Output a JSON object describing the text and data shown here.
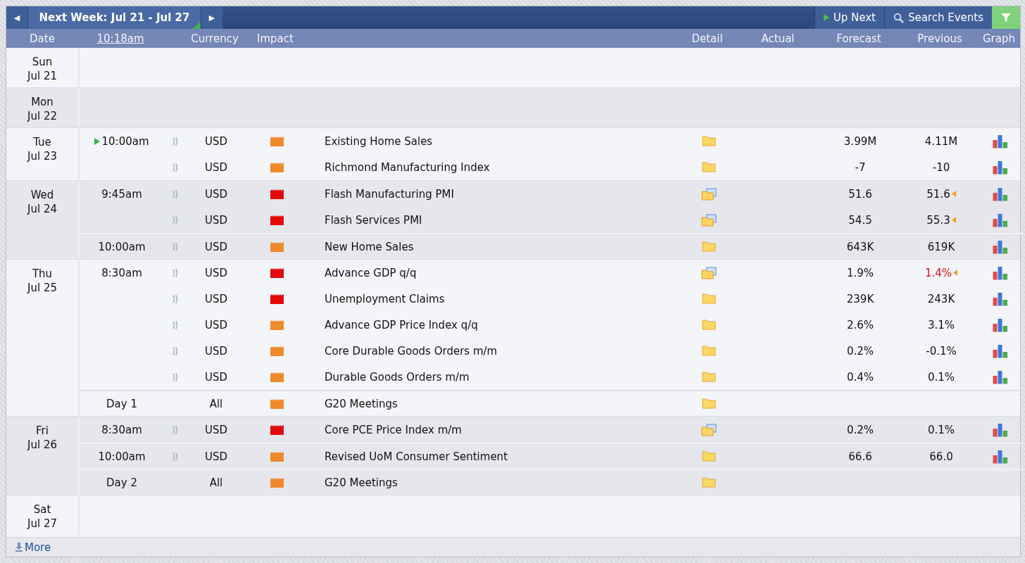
{
  "toolbar": {
    "prev": "◀",
    "title": "Next Week: Jul 21 - Jul 27",
    "next": "▶",
    "up_next": "Up Next",
    "search": "Search Events"
  },
  "columns": [
    {
      "label": "Date",
      "kind": "text"
    },
    {
      "label": "10:18am",
      "kind": "link"
    },
    {
      "label": "Currency",
      "kind": "text"
    },
    {
      "label": "Impact",
      "kind": "text"
    },
    {
      "label": "Detail",
      "kind": "text"
    },
    {
      "label": "Actual",
      "kind": "text"
    },
    {
      "label": "Forecast",
      "kind": "text"
    },
    {
      "label": "Previous",
      "kind": "text"
    },
    {
      "label": "Graph",
      "kind": "text"
    }
  ],
  "days": [
    {
      "day": "Sun",
      "date": "Jul 21"
    },
    {
      "day": "Mon",
      "date": "Jul 22"
    },
    {
      "day": "Tue",
      "date": "Jul 23",
      "events": [
        {
          "time": "10:00am",
          "up_next": true,
          "alert": true,
          "currency": "USD",
          "impact": {
            "color": "#ef8a2b"
          },
          "title": "Existing Home Sales",
          "detail": {
            "kind": "folder"
          },
          "forecast": "3.99M",
          "previous": "4.11M",
          "previous_worse": false,
          "revised": false,
          "graph": true
        },
        {
          "up_next": false,
          "alert": true,
          "currency": "USD",
          "impact": {
            "color": "#ef8a2b"
          },
          "title": "Richmond Manufacturing Index",
          "detail": {
            "kind": "folder"
          },
          "forecast": "-7",
          "previous": "-10",
          "previous_worse": false,
          "revised": false,
          "graph": true
        }
      ]
    },
    {
      "day": "Wed",
      "date": "Jul 24",
      "events": [
        {
          "time": "9:45am",
          "up_next": false,
          "alert": true,
          "currency": "USD",
          "impact": {
            "color": "#e20a0a"
          },
          "title": "Flash Manufacturing PMI",
          "detail": {
            "kind": "folder-doc"
          },
          "forecast": "51.6",
          "previous": "51.6",
          "previous_worse": false,
          "revised": true,
          "graph": true
        },
        {
          "up_next": false,
          "alert": true,
          "currency": "USD",
          "impact": {
            "color": "#e20a0a"
          },
          "title": "Flash Services PMI",
          "detail": {
            "kind": "folder-doc"
          },
          "forecast": "54.5",
          "previous": "55.3",
          "previous_worse": false,
          "revised": true,
          "graph": true
        },
        {
          "time": "10:00am",
          "up_next": false,
          "alert": true,
          "currency": "USD",
          "impact": {
            "color": "#ef8a2b"
          },
          "title": "New Home Sales",
          "detail": {
            "kind": "folder"
          },
          "forecast": "643K",
          "previous": "619K",
          "previous_worse": false,
          "revised": false,
          "graph": true
        }
      ]
    },
    {
      "day": "Thu",
      "date": "Jul 25",
      "events": [
        {
          "time": "8:30am",
          "up_next": false,
          "alert": true,
          "currency": "USD",
          "impact": {
            "color": "#e20a0a"
          },
          "title": "Advance GDP q/q",
          "detail": {
            "kind": "folder-doc"
          },
          "forecast": "1.9%",
          "previous": "1.4%",
          "previous_worse": true,
          "revised": true,
          "graph": true
        },
        {
          "up_next": false,
          "alert": true,
          "currency": "USD",
          "impact": {
            "color": "#e20a0a"
          },
          "title": "Unemployment Claims",
          "detail": {
            "kind": "folder"
          },
          "forecast": "239K",
          "previous": "243K",
          "previous_worse": false,
          "revised": false,
          "graph": true
        },
        {
          "up_next": false,
          "alert": true,
          "currency": "USD",
          "impact": {
            "color": "#ef8a2b"
          },
          "title": "Advance GDP Price Index q/q",
          "detail": {
            "kind": "folder"
          },
          "forecast": "2.6%",
          "previous": "3.1%",
          "previous_worse": false,
          "revised": false,
          "graph": true
        },
        {
          "up_next": false,
          "alert": true,
          "currency": "USD",
          "impact": {
            "color": "#ef8a2b"
          },
          "title": "Core Durable Goods Orders m/m",
          "detail": {
            "kind": "folder"
          },
          "forecast": "0.2%",
          "previous": "-0.1%",
          "previous_worse": false,
          "revised": false,
          "graph": true
        },
        {
          "up_next": false,
          "alert": true,
          "currency": "USD",
          "impact": {
            "color": "#ef8a2b"
          },
          "title": "Durable Goods Orders m/m",
          "detail": {
            "kind": "folder"
          },
          "forecast": "0.4%",
          "previous": "0.1%",
          "previous_worse": false,
          "revised": false,
          "graph": true
        },
        {
          "time": "Day 1",
          "up_next": false,
          "alert": false,
          "currency": "All",
          "impact": {
            "color": "#ef8a2b"
          },
          "title": "G20 Meetings",
          "detail": {
            "kind": "folder"
          },
          "revised": false,
          "graph": false
        }
      ]
    },
    {
      "day": "Fri",
      "date": "Jul 26",
      "events": [
        {
          "time": "8:30am",
          "up_next": false,
          "alert": true,
          "currency": "USD",
          "impact": {
            "color": "#e20a0a"
          },
          "title": "Core PCE Price Index m/m",
          "detail": {
            "kind": "folder-doc"
          },
          "forecast": "0.2%",
          "previous": "0.1%",
          "previous_worse": false,
          "revised": false,
          "graph": true
        },
        {
          "time": "10:00am",
          "up_next": false,
          "alert": true,
          "currency": "USD",
          "impact": {
            "color": "#ef8a2b"
          },
          "title": "Revised UoM Consumer Sentiment",
          "detail": {
            "kind": "folder"
          },
          "forecast": "66.6",
          "previous": "66.0",
          "previous_worse": false,
          "revised": false,
          "graph": true
        },
        {
          "time": "Day 2",
          "up_next": false,
          "alert": false,
          "currency": "All",
          "impact": {
            "color": "#ef8a2b"
          },
          "title": "G20 Meetings",
          "detail": {
            "kind": "folder"
          },
          "revised": false,
          "graph": false
        }
      ]
    },
    {
      "day": "Sat",
      "date": "Jul 27"
    }
  ],
  "footer": {
    "more": "More"
  }
}
